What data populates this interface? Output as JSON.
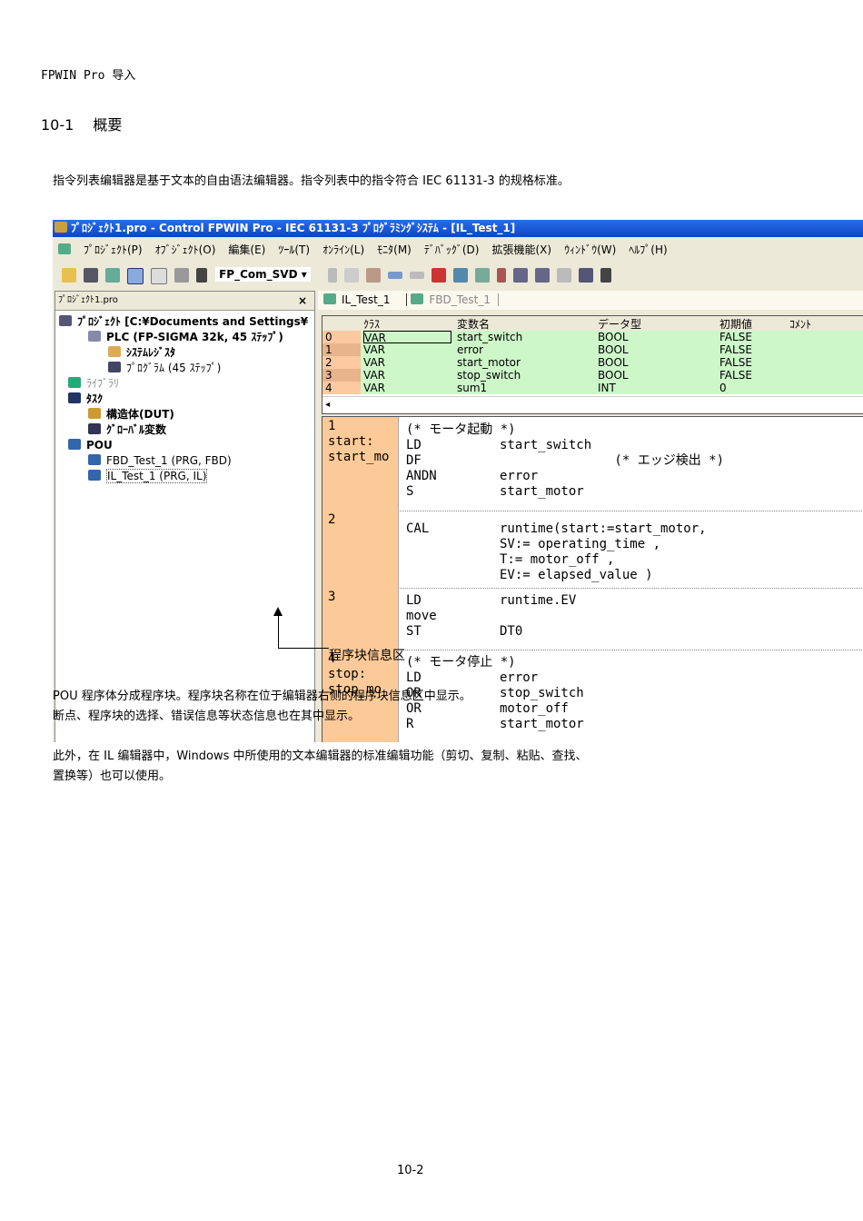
{
  "header": "FPWIN Pro 导入",
  "section": "10-1　 概要",
  "intro": "指令列表编辑器是基于文本的自由语法编辑器。指令列表中的指令符合 IEC 61131-3 的规格标准。",
  "app": {
    "title": "ﾌﾟﾛｼﾞｪｸﾄ1.pro - Control FPWIN Pro - IEC 61131-3 ﾌﾟﾛｸﾞﾗﾐﾝｸﾞｼｽﾃﾑ - [IL_Test_1]",
    "menu": [
      "ﾌﾟﾛｼﾞｪｸﾄ(P)",
      "ｵﾌﾞｼﾞｪｸﾄ(O)",
      "編集(E)",
      "ﾂｰﾙ(T)",
      "ｵﾝﾗｲﾝ(L)",
      "ﾓﾆﾀ(M)",
      "ﾃﾞﾊﾞｯｸﾞ(D)",
      "拡張機能(X)",
      "ｳｨﾝﾄﾞｳ(W)",
      "ﾍﾙﾌﾟ(H)"
    ],
    "toolbar_combo": "FP_Com_SVD",
    "left_pane_title": "ﾌﾟﾛｼﾞｪｸﾄ1.pro",
    "close": "×",
    "tree": [
      "ﾌﾟﾛｼﾞｪｸﾄ [C:¥Documents and Settings¥",
      "PLC (FP-SIGMA 32k, 45 ｽﾃｯﾌﾟ)",
      "ｼｽﾃﾑﾚｼﾞｽﾀ",
      "ﾌﾟﾛｸﾞﾗﾑ (45 ｽﾃｯﾌﾟ)",
      "ﾗｲﾌﾞﾗﾘ",
      "ﾀｽｸ",
      "構造体(DUT)",
      "ｸﾞﾛｰﾊﾞﾙ変数",
      "POU",
      "FBD_Test_1 (PRG, FBD)",
      "IL_Test_1 (PRG, IL)"
    ],
    "tabs": [
      "IL_Test_1",
      "FBD_Test_1"
    ],
    "var_headers": [
      "ｸﾗｽ",
      "変数名",
      "データ型",
      "初期値",
      "ｺﾒﾝﾄ"
    ],
    "vars": [
      [
        "0",
        "VAR",
        "start_switch",
        "BOOL",
        "FALSE"
      ],
      [
        "1",
        "VAR",
        "error",
        "BOOL",
        "FALSE"
      ],
      [
        "2",
        "VAR",
        "start_motor",
        "BOOL",
        "FALSE"
      ],
      [
        "3",
        "VAR",
        "stop_switch",
        "BOOL",
        "FALSE"
      ],
      [
        "4",
        "VAR",
        "sum1",
        "INT",
        "0"
      ]
    ],
    "blocks": [
      {
        "info": [
          "1",
          "start:",
          "start_mo"
        ],
        "lines": [
          [
            "(* モータ起動 *)",
            ""
          ],
          [
            "LD",
            "start_switch"
          ],
          [
            "DF",
            "               (* エッジ検出 *)"
          ],
          [
            "ANDN",
            "error"
          ],
          [
            "S",
            "start_motor"
          ]
        ]
      },
      {
        "info": [
          "2"
        ],
        "lines": [
          [
            "CAL",
            "runtime(start:=start_motor,"
          ],
          [
            "",
            "SV:= operating_time ,"
          ],
          [
            "",
            "T:= motor_off ,"
          ],
          [
            "",
            "EV:= elapsed_value )"
          ]
        ]
      },
      {
        "info": [
          "3"
        ],
        "lines": [
          [
            "LD",
            "runtime.EV"
          ],
          [
            "move",
            ""
          ],
          [
            "ST",
            "DT0"
          ]
        ]
      },
      {
        "info": [
          "4",
          "stop:",
          "stop_mo"
        ],
        "lines": [
          [
            "(* モータ停止 *)",
            ""
          ],
          [
            "LD",
            "error"
          ],
          [
            "OR",
            "stop_switch"
          ],
          [
            "OR",
            "motor_off"
          ],
          [
            "R",
            "start_motor"
          ]
        ]
      }
    ]
  },
  "annotation": "程序块信息区",
  "para1": [
    "POU 程序体分成程序块。程序块名称在位于编辑器右侧的程序块信息区中显示。",
    "断点、程序块的选择、错误信息等状态信息也在其中显示。"
  ],
  "para2": [
    "此外，在 IL 编辑器中，Windows 中所使用的文本编辑器的标准编辑功能（剪切、复制、粘贴、查找、",
    "置换等）也可以使用。"
  ],
  "footer": "10-2"
}
